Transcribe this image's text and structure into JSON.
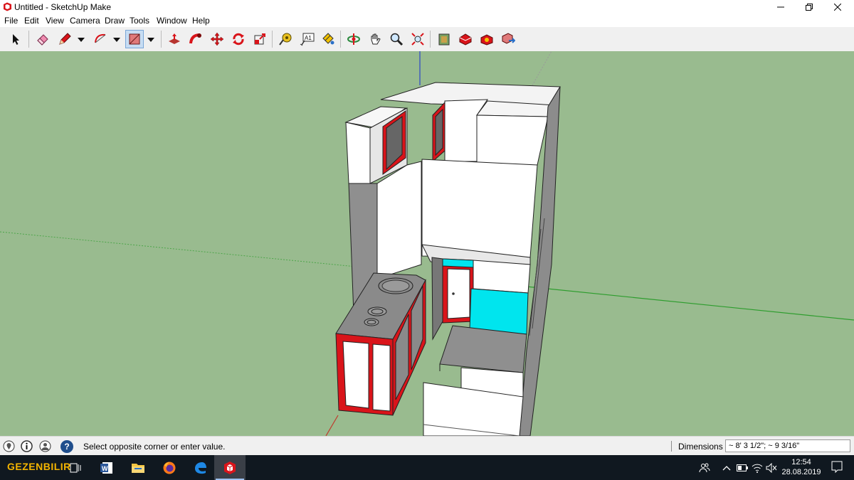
{
  "window": {
    "title": "Untitled - SketchUp Make",
    "app_icon": "sketchup-icon",
    "controls": [
      "minimize-icon",
      "maximize-icon",
      "close-icon"
    ]
  },
  "menu": {
    "items": [
      "File",
      "Edit",
      "View",
      "Camera",
      "Draw",
      "Tools",
      "Window",
      "Help"
    ]
  },
  "toolbar": {
    "tools": [
      {
        "name": "select-tool",
        "icon": "arrow-cursor-icon"
      },
      {
        "name": "eraser-tool",
        "icon": "eraser-icon"
      },
      {
        "name": "line-tool",
        "icon": "pencil-icon"
      },
      {
        "name": "arc-tool",
        "icon": "arc-icon"
      },
      {
        "name": "rectangle-tool",
        "icon": "rectangle-icon",
        "active": true
      },
      {
        "name": "push-pull-tool",
        "icon": "push-pull-icon"
      },
      {
        "name": "follow-me-tool",
        "icon": "follow-me-icon"
      },
      {
        "name": "move-tool",
        "icon": "move-icon"
      },
      {
        "name": "rotate-tool",
        "icon": "rotate-icon"
      },
      {
        "name": "scale-tool",
        "icon": "scale-icon"
      },
      {
        "name": "tape-measure-tool",
        "icon": "tape-measure-icon"
      },
      {
        "name": "text-tool",
        "icon": "text-icon"
      },
      {
        "name": "paint-bucket-tool",
        "icon": "paint-bucket-icon"
      },
      {
        "name": "orbit-tool",
        "icon": "orbit-icon"
      },
      {
        "name": "pan-tool",
        "icon": "pan-hand-icon"
      },
      {
        "name": "zoom-tool",
        "icon": "zoom-icon"
      },
      {
        "name": "zoom-extents-tool",
        "icon": "zoom-extents-icon"
      },
      {
        "name": "warehouse-tool",
        "icon": "warehouse-icon"
      },
      {
        "name": "extension-warehouse-tool",
        "icon": "extension-icon"
      },
      {
        "name": "components-tool",
        "icon": "components-icon"
      },
      {
        "name": "share-model-tool",
        "icon": "share-model-icon"
      }
    ],
    "text_tool_glyph": "A1"
  },
  "viewport": {
    "background": "#99bb8f",
    "red_axis": "#c0392b",
    "green_axis": "#2e9d2e",
    "blue_axis": "#2b46c8",
    "accent_red": "#d9141a",
    "accent_cyan": "#00e5ee"
  },
  "status": {
    "message": "Select opposite corner or enter value.",
    "icons": [
      "geo-location-icon",
      "credits-icon",
      "user-icon",
      "help-icon"
    ],
    "help_glyph": "?",
    "vcb_label": "Dimensions",
    "vcb_value": "~ 8' 3 1/2\"; ~ 9 3/16\""
  },
  "taskbar": {
    "logo": "GEZENBILIR",
    "apps": [
      "task-view-icon",
      "word-icon",
      "file-explorer-icon",
      "firefox-icon",
      "edge-icon",
      "sketchup-icon"
    ],
    "tray": [
      "people-icon",
      "chevron-up-icon",
      "battery-icon",
      "wifi-icon",
      "volume-mute-icon"
    ],
    "time": "12:54",
    "date": "28.08.2019"
  }
}
